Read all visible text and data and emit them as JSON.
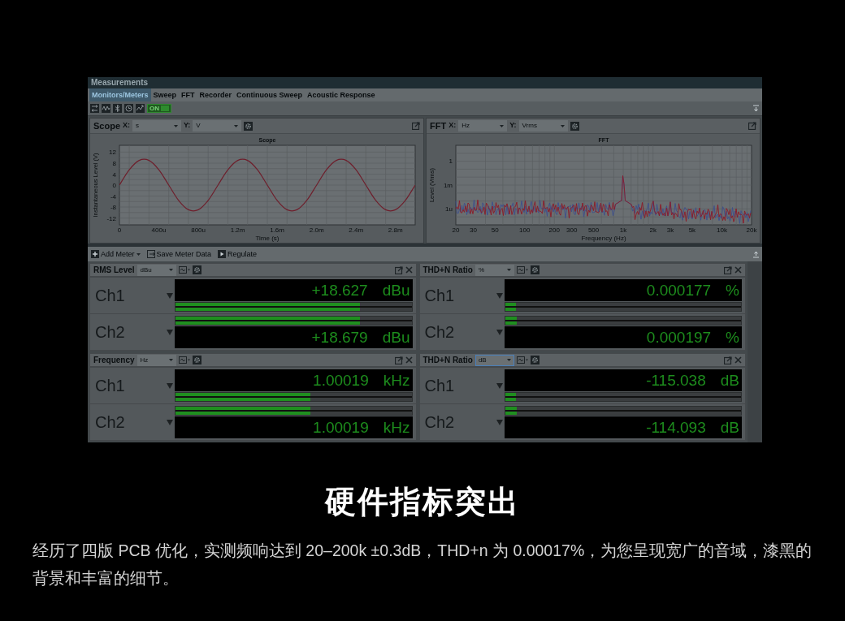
{
  "window": {
    "title": "Measurements"
  },
  "tabs": [
    {
      "label": "Monitors/Meters",
      "selected": true
    },
    {
      "label": "Sweep",
      "selected": false
    },
    {
      "label": "FFT",
      "selected": false
    },
    {
      "label": "Recorder",
      "selected": false
    },
    {
      "label": "Continuous Sweep",
      "selected": false
    },
    {
      "label": "Acoustic Response",
      "selected": false
    }
  ],
  "toolbar": {
    "toggle": {
      "label": "ON",
      "on": true
    }
  },
  "graphs": [
    {
      "title": "Scope",
      "x_label": "X:",
      "x_unit": "s",
      "y_label": "Y:",
      "y_unit": "V",
      "chart_data": {
        "type": "line",
        "title": "Scope",
        "xlabel": "Time (s)",
        "ylabel": "Instantaneous Level (V)",
        "categories": [
          "0",
          null,
          null,
          null,
          "400u",
          null,
          null,
          null,
          "800u",
          null,
          null,
          null,
          "1.2m",
          null,
          null,
          null,
          "1.6m",
          null,
          null,
          null,
          "2.0m",
          null,
          null,
          null,
          "2.4m",
          null,
          null,
          null,
          "2.8m",
          null,
          null
        ],
        "series": [
          {
            "color": "#6e1f2c",
            "values": [
              0,
              5.6,
              9,
              9,
              5.6,
              0,
              -5.6,
              -9,
              -9,
              -5.6,
              0,
              5.6,
              9,
              9,
              5.6,
              0,
              -5.6,
              -9,
              -9,
              -5.6,
              0,
              5.6,
              9,
              9,
              5.6,
              0,
              -5.6,
              -9,
              -9,
              -5.6,
              0
            ]
          }
        ],
        "ylim": [
          -14.5,
          14.5
        ],
        "grid": true,
        "yticks": [
          -12,
          -8,
          -4,
          0,
          4,
          8,
          12
        ]
      }
    },
    {
      "title": "FFT",
      "x_label": "X:",
      "x_unit": "Hz",
      "y_label": "Y:",
      "y_unit": "Vrms",
      "plot": {
        "kind": "spectrum",
        "title": "FFT",
        "xlabel": "Frequency (Hz)",
        "ylabel": "Level (Vrms)",
        "x_tick_labels": [
          "20",
          "30",
          "50",
          "100",
          "200",
          "300",
          "500",
          "1k",
          "2k",
          "3k",
          "5k",
          "10k",
          "20k"
        ],
        "y_tick_labels": [
          "1",
          "1m",
          "1u"
        ]
      }
    }
  ],
  "meter_toolbar": [
    {
      "kind": "add",
      "label": "Add Meter"
    },
    {
      "kind": "save",
      "label": "Save Meter Data"
    },
    {
      "kind": "play",
      "label": "Regulate"
    }
  ],
  "meters": [
    {
      "title": "RMS Level",
      "unit": "dBu",
      "focused": false,
      "channels": [
        {
          "name": "Ch1",
          "value": "+18.627",
          "unit": "dBu",
          "level": 0.78
        },
        {
          "name": "Ch2",
          "value": "+18.679",
          "unit": "dBu",
          "level": 0.78
        }
      ]
    },
    {
      "title": "THD+N Ratio",
      "unit": "%",
      "focused": false,
      "channels": [
        {
          "name": "Ch1",
          "value": "0.000177",
          "unit": "%",
          "level": 0.045
        },
        {
          "name": "Ch2",
          "value": "0.000197",
          "unit": "%",
          "level": 0.05
        }
      ]
    },
    {
      "title": "Frequency",
      "unit": "Hz",
      "focused": false,
      "channels": [
        {
          "name": "Ch1",
          "value": "1.00019",
          "unit": "kHz",
          "level": 0.57
        },
        {
          "name": "Ch2",
          "value": "1.00019",
          "unit": "kHz",
          "level": 0.57
        }
      ]
    },
    {
      "title": "THD+N Ratio",
      "unit": "dB",
      "focused": true,
      "channels": [
        {
          "name": "Ch1",
          "value": "-115.038",
          "unit": "dB",
          "level": 0.045
        },
        {
          "name": "Ch2",
          "value": "-114.093",
          "unit": "dB",
          "level": 0.05
        }
      ]
    }
  ],
  "headline": "硬件指标突出",
  "description": "经历了四版 PCB 优化，实测频响达到 20–200k ±0.3dB，THD+n 为 0.00017%，为您呈现宽广的音域，漆黑的背景和丰富的细节。"
}
